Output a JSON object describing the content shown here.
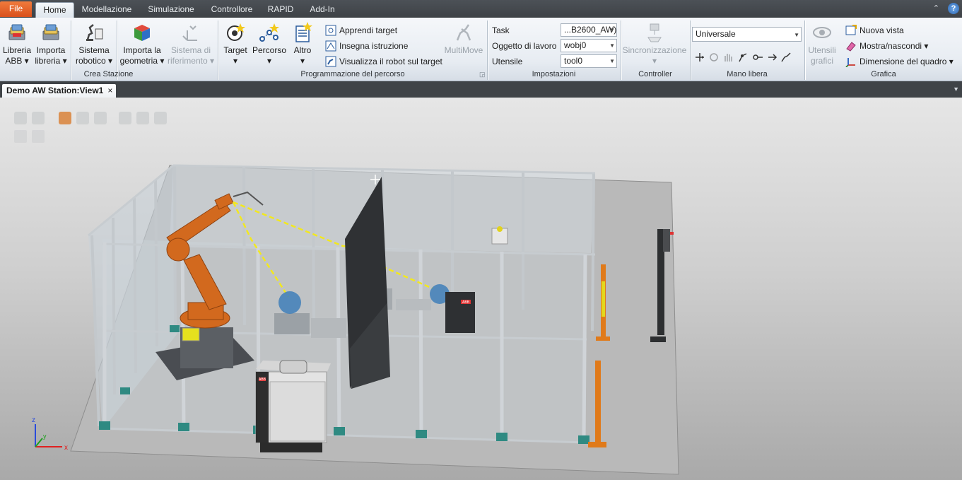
{
  "menu": {
    "tabs": [
      {
        "label": "File"
      },
      {
        "label": "Home"
      },
      {
        "label": "Modellazione"
      },
      {
        "label": "Simulazione"
      },
      {
        "label": "Controllore"
      },
      {
        "label": "RAPID"
      },
      {
        "label": "Add-In"
      }
    ],
    "help_label": "?"
  },
  "ribbon": {
    "crea_stazione": {
      "label": "Crea Stazione",
      "libreria_abb": [
        "Libreria",
        "ABB"
      ],
      "importa_libreria": [
        "Importa",
        "libreria"
      ],
      "sistema_robotico": [
        "Sistema",
        "robotico"
      ],
      "importa_geometria": [
        "Importa la",
        "geometria"
      ],
      "sistema_riferimento": [
        "Sistema di",
        "riferimento"
      ]
    },
    "programmazione": {
      "label": "Programmazione del percorso",
      "target": "Target",
      "percorso": "Percorso",
      "altro": "Altro",
      "apprendi_target": "Apprendi target",
      "insegna_istruzione": "Insegna istruzione",
      "visualizza_robot": "Visualizza il robot sul target",
      "multimove": "MultiMove"
    },
    "impostazioni": {
      "label": "Impostazioni",
      "task_label": "Task",
      "task_value": "...B2600_AW)",
      "oggetto_label": "Oggetto di lavoro",
      "oggetto_value": "wobj0",
      "utensile_label": "Utensile",
      "utensile_value": "tool0"
    },
    "controller": {
      "label": "Controller",
      "sincronizzazione": "Sincronizzazione"
    },
    "mano_libera": {
      "label": "Mano libera",
      "frame_value": "Universale"
    },
    "grafica": {
      "label": "Grafica",
      "utensili_grafici": [
        "Utensili",
        "grafici"
      ],
      "nuova_vista": "Nuova vista",
      "mostra_nascondi": "Mostra/nascondi",
      "dimensione_quadro": "Dimensione del quadro"
    }
  },
  "document": {
    "tab_title": "Demo AW Station:View1",
    "close": "×"
  },
  "viewport": {
    "axes": {
      "x": "x",
      "y": "y",
      "z": "z"
    },
    "controller_badge": "ABB",
    "cabinet_badge": "ABB"
  },
  "colors": {
    "accent_file_tab": "#e8632a",
    "robot_orange": "#d2691e",
    "path_yellow": "#f2e81e",
    "floor": "#b9b9b9"
  }
}
